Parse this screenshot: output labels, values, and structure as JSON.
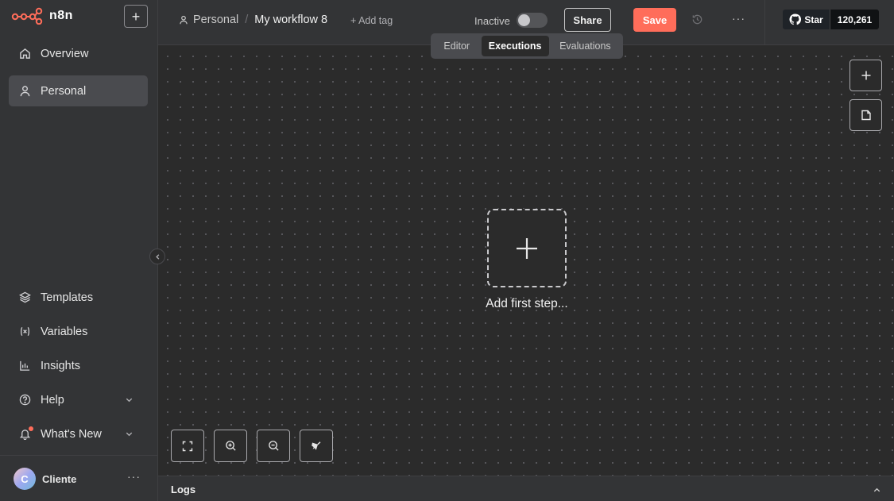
{
  "app": {
    "logo_text": "n8n",
    "brand_color": "#ff6d5a"
  },
  "sidebar": {
    "new_button": "+",
    "top_items": [
      {
        "label": "Overview",
        "icon": "home-icon"
      },
      {
        "label": "Personal",
        "icon": "user-icon",
        "active": true
      }
    ],
    "bottom_items": [
      {
        "label": "Templates",
        "icon": "templates-icon"
      },
      {
        "label": "Variables",
        "icon": "variables-icon"
      },
      {
        "label": "Insights",
        "icon": "insights-icon"
      },
      {
        "label": "Help",
        "icon": "help-icon"
      },
      {
        "label": "What's New",
        "icon": "bell-icon"
      }
    ],
    "user": {
      "initial": "C",
      "name": "Cliente",
      "more": "···"
    }
  },
  "header": {
    "project": "Personal",
    "separator": "/",
    "workflow_name": "My workflow 8",
    "add_tag": "+ Add tag",
    "status_label": "Inactive",
    "share_label": "Share",
    "save_label": "Save",
    "more": "···",
    "github": {
      "star_label": "Star",
      "count": "120,261"
    }
  },
  "tabs": [
    {
      "label": "Editor"
    },
    {
      "label": "Executions",
      "active": true
    },
    {
      "label": "Evaluations"
    }
  ],
  "canvas": {
    "first_step_label": "Add first step..."
  },
  "logs": {
    "label": "Logs"
  }
}
